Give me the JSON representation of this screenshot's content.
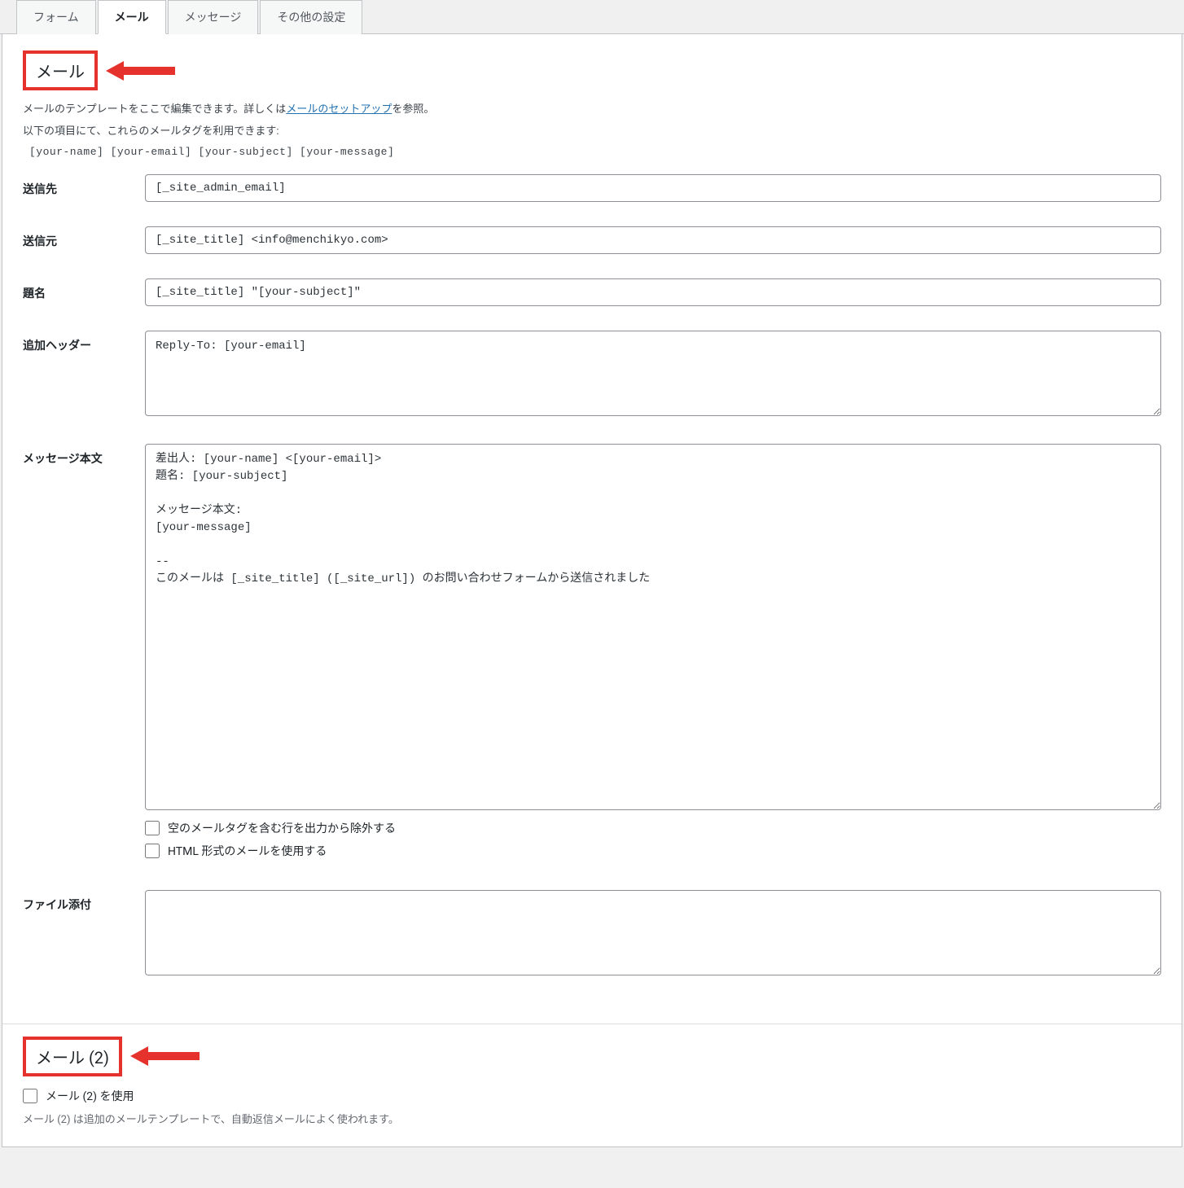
{
  "tabs": [
    {
      "label": "フォーム"
    },
    {
      "label": "メール"
    },
    {
      "label": "メッセージ"
    },
    {
      "label": "その他の設定"
    }
  ],
  "active_tab_index": 1,
  "mail1": {
    "heading": "メール",
    "desc_prefix": "メールのテンプレートをここで編集できます。詳しくは",
    "desc_link": "メールのセットアップ",
    "desc_suffix": "を参照。",
    "tags_intro": "以下の項目にて、これらのメールタグを利用できます:",
    "tags": "[your-name] [your-email] [your-subject] [your-message]",
    "fields": {
      "to_label": "送信先",
      "to_value": "[_site_admin_email]",
      "from_label": "送信元",
      "from_value": "[_site_title] <info@menchikyo.com>",
      "subject_label": "題名",
      "subject_value": "[_site_title] \"[your-subject]\"",
      "headers_label": "追加ヘッダー",
      "headers_value": "Reply-To: [your-email]",
      "body_label": "メッセージ本文",
      "body_value": "差出人: [your-name] <[your-email]>\n題名: [your-subject]\n\nメッセージ本文:\n[your-message]\n\n-- \nこのメールは [_site_title] ([_site_url]) のお問い合わせフォームから送信されました",
      "exclude_blank_label": "空のメールタグを含む行を出力から除外する",
      "use_html_label": "HTML 形式のメールを使用する",
      "attachments_label": "ファイル添付",
      "attachments_value": ""
    }
  },
  "mail2": {
    "heading": "メール (2)",
    "use_label": "メール (2) を使用",
    "desc": "メール (2) は追加のメールテンプレートで、自動返信メールによく使われます。"
  }
}
